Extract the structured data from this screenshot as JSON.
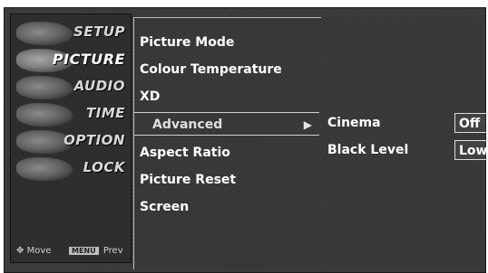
{
  "categories": [
    {
      "label": "SETUP",
      "icon": "setup-icon"
    },
    {
      "label": "PICTURE",
      "icon": "picture-icon"
    },
    {
      "label": "AUDIO",
      "icon": "audio-icon"
    },
    {
      "label": "TIME",
      "icon": "time-icon"
    },
    {
      "label": "OPTION",
      "icon": "option-icon"
    },
    {
      "label": "LOCK",
      "icon": "lock-icon"
    }
  ],
  "active_category": "PICTURE",
  "hints": {
    "move_symbol": "✥",
    "move_label": "Move",
    "prev_key": "MENU",
    "prev_label": "Prev"
  },
  "menu": {
    "items": [
      {
        "label": "Picture Mode"
      },
      {
        "label": "Colour Temperature"
      },
      {
        "label": "XD"
      },
      {
        "label": "Advanced"
      },
      {
        "label": "Aspect Ratio"
      },
      {
        "label": "Picture Reset"
      },
      {
        "label": "Screen"
      }
    ],
    "selected": "Advanced",
    "arrow": "▶"
  },
  "submenu": {
    "rows": [
      {
        "label": "Cinema",
        "value": "Off"
      },
      {
        "label": "Black Level",
        "value": "Low"
      }
    ]
  }
}
